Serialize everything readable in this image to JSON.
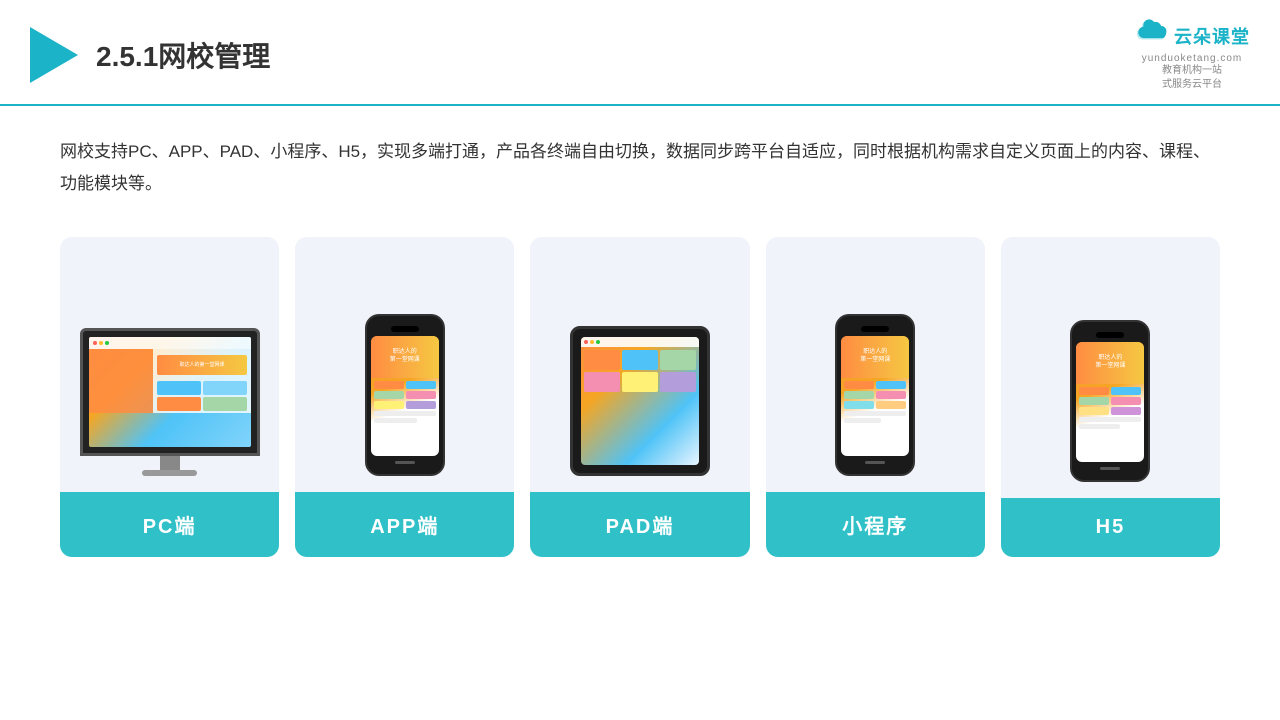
{
  "header": {
    "section_number": "2.5.1",
    "title": "网校管理",
    "brand": {
      "name": "云朵课堂",
      "url": "yunduoketang.com",
      "tagline": "教育机构一站\n式服务云平台"
    }
  },
  "main": {
    "description": "网校支持PC、APP、PAD、小程序、H5，实现多端打通，产品各终端自由切换，数据同步跨平台自适应，同时根据机构需求自定义页面上的内容、课程、功能模块等。",
    "cards": [
      {
        "id": "pc",
        "label": "PC端"
      },
      {
        "id": "app",
        "label": "APP端"
      },
      {
        "id": "pad",
        "label": "PAD端"
      },
      {
        "id": "mini",
        "label": "小程序"
      },
      {
        "id": "h5",
        "label": "H5"
      }
    ]
  }
}
